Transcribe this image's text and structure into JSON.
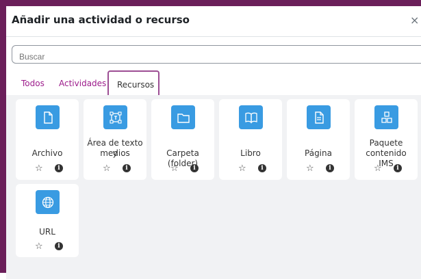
{
  "dialog": {
    "title": "Añadir una actividad o recurso",
    "close_glyph": "×"
  },
  "search": {
    "placeholder": "Buscar"
  },
  "tabs": [
    {
      "label": "Todos"
    },
    {
      "label": "Actividades"
    },
    {
      "label": "Recursos",
      "active": true
    }
  ],
  "items": [
    {
      "name": "Archivo",
      "icon": "file-icon"
    },
    {
      "name_line1": "Área de texto y",
      "name_line2": "medios",
      "icon": "text-media-icon"
    },
    {
      "name": "Carpeta (folder)",
      "icon": "folder-icon"
    },
    {
      "name": "Libro",
      "icon": "book-icon"
    },
    {
      "name": "Página",
      "icon": "page-icon"
    },
    {
      "name_line1": "Paquete",
      "name_line2": "contenido IMS",
      "icon": "ims-package-icon"
    },
    {
      "name": "URL",
      "icon": "globe-icon"
    }
  ],
  "action_glyphs": {
    "star": "☆",
    "info": "i"
  },
  "colors": {
    "frame": "#6b1f5a",
    "icon_bg": "#399be2",
    "tab_link": "#9c1b8b",
    "grid_bg": "#f1f2f4"
  }
}
